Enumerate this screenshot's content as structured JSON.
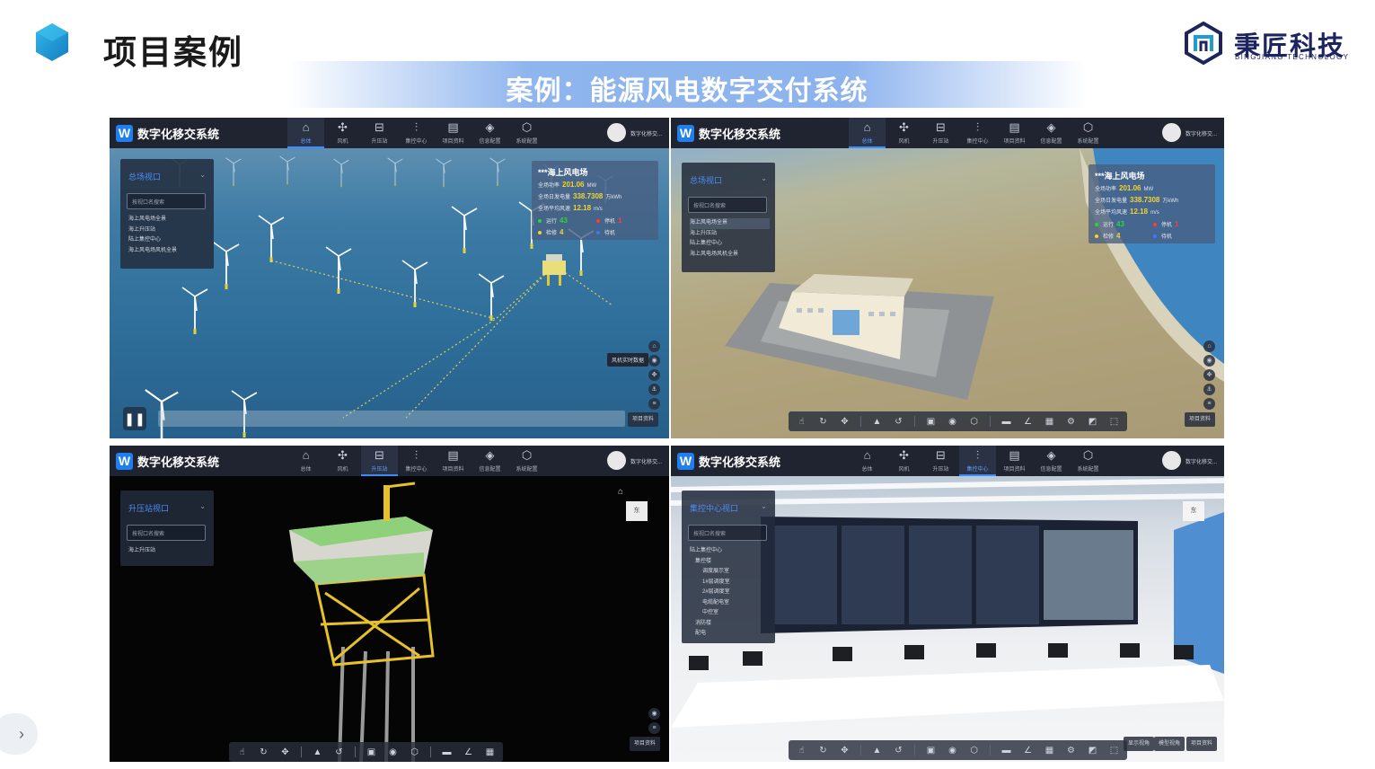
{
  "slide": {
    "title": "项目案例",
    "subtitle": "案例：能源风电数字交付系统",
    "logo": {
      "name": "秉匠科技",
      "tagline": "BINGJIANG TECHNOLOGY"
    },
    "colors": {
      "accent": "#1f9bd8",
      "brand": "#1d2460",
      "band": "#8fb5ee"
    }
  },
  "app": {
    "title": "数字化移交系统",
    "logo_letter": "W",
    "user": "数字化移交...",
    "nav": [
      {
        "icon": "home-icon",
        "label": "总体"
      },
      {
        "icon": "fan-icon",
        "label": "风机"
      },
      {
        "icon": "substation-icon",
        "label": "升压站"
      },
      {
        "icon": "sliders-icon",
        "label": "集控中心"
      },
      {
        "icon": "document-icon",
        "label": "项目资料"
      },
      {
        "icon": "layers-icon",
        "label": "信息配置"
      },
      {
        "icon": "settings-icon",
        "label": "系统配置"
      }
    ]
  },
  "panel1": {
    "active_nav": 0,
    "side": {
      "title": "总场视口",
      "search_placeholder": "按视口名搜索",
      "items": [
        "海上风电场全景",
        "海上升压站",
        "陆上集控中心",
        "海上风电场风机全景"
      ]
    },
    "info": {
      "title": "***海上风电场",
      "rows": [
        {
          "label": "全场功率",
          "value": "201.06",
          "unit": "MW"
        },
        {
          "label": "全场日发电量",
          "value": "338.7308",
          "unit": "万kWh"
        },
        {
          "label": "全场平均风速",
          "value": "12.18",
          "unit": "m/s"
        }
      ],
      "status": [
        {
          "label": "运行",
          "value": "43",
          "color": "#2fd33a"
        },
        {
          "label": "停机",
          "value": "1",
          "color": "#ff3b3b"
        },
        {
          "label": "检修",
          "value": "4",
          "color": "#f4d330"
        },
        {
          "label": "待机",
          "value": "",
          "color": "#3a78ff"
        }
      ]
    },
    "tooltip": "风机实时数据",
    "corner": "项目资料"
  },
  "panel2": {
    "active_nav": 0,
    "side": {
      "title": "总场视口",
      "search_placeholder": "按视口名搜索",
      "items": [
        "海上风电场全景",
        "海上升压站",
        "陆上集控中心",
        "海上风电场风机全景"
      ]
    },
    "info": {
      "title": "***海上风电场",
      "rows": [
        {
          "label": "全场功率",
          "value": "201.06",
          "unit": "MW"
        },
        {
          "label": "全场日发电量",
          "value": "338.7308",
          "unit": "万kWh"
        },
        {
          "label": "全场平均风速",
          "value": "12.18",
          "unit": "m/s"
        }
      ],
      "status": [
        {
          "label": "运行",
          "value": "43",
          "color": "#2fd33a"
        },
        {
          "label": "停机",
          "value": "1",
          "color": "#ff3b3b"
        },
        {
          "label": "检修",
          "value": "4",
          "color": "#f4d330"
        },
        {
          "label": "待机",
          "value": "",
          "color": "#3a78ff"
        }
      ]
    },
    "corner": "项目资料"
  },
  "panel3": {
    "active_nav": 2,
    "side": {
      "title": "升压站视口",
      "search_placeholder": "按视口名搜索",
      "items": [
        "海上升压站"
      ]
    },
    "cube_label": "东",
    "corner": "项目资料"
  },
  "panel4": {
    "active_nav": 3,
    "side": {
      "title": "集控中心视口",
      "search_placeholder": "按视口名搜索",
      "items": [
        "陆上集控中心",
        "集控楼",
        "调度展示室",
        "1#层调度室",
        "2#层调度室",
        "电缆配电室",
        "中控室",
        "消防楼",
        "配电"
      ]
    },
    "cube_label": "东",
    "corner_buttons": [
      "显示视角",
      "模型视角",
      "项目资料"
    ]
  }
}
